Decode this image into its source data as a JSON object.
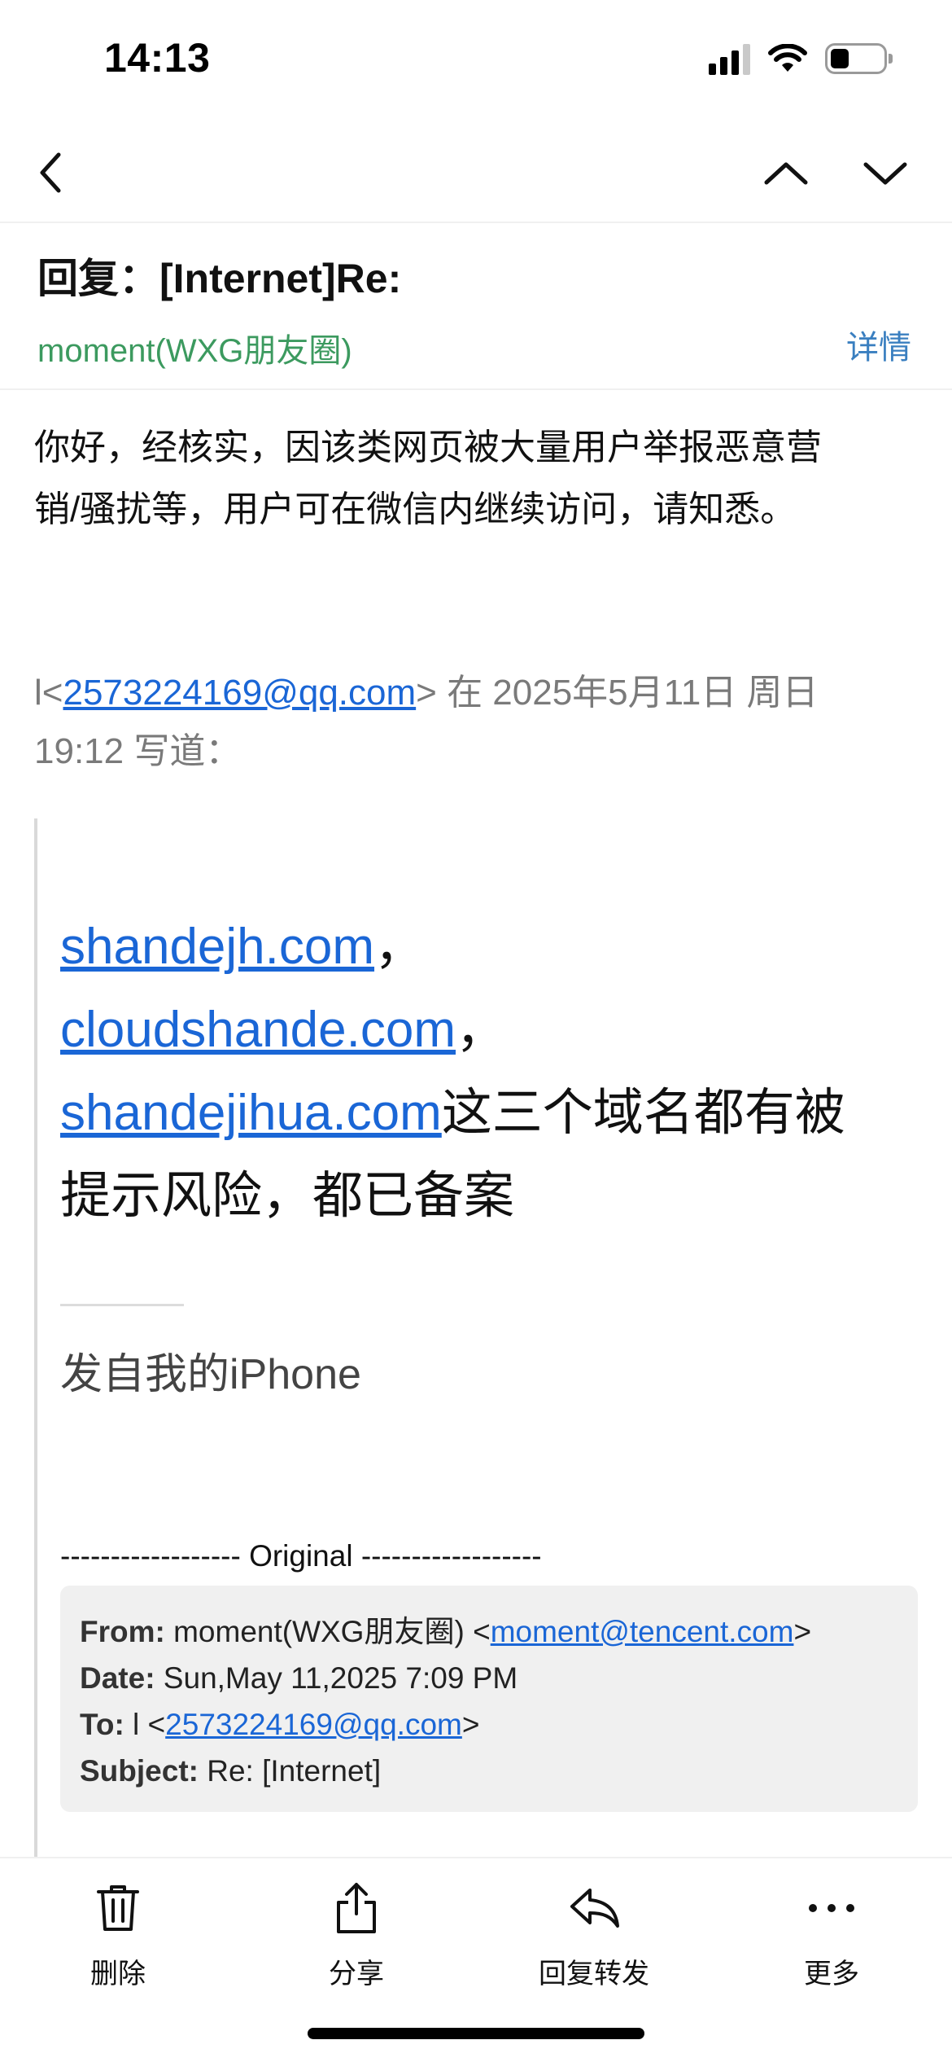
{
  "status_bar": {
    "time": "14:13"
  },
  "header": {
    "subject": "回复：[Internet]Re:",
    "sender": "moment(WXG朋友圈)",
    "details_label": "详情"
  },
  "body": {
    "line1": "你好，经核实，因该类网页被大量用户举报恶意营",
    "line2": "销/骚扰等，用户可在微信内继续访问，请知悉。"
  },
  "quote": {
    "prefix": "l<",
    "email": "2573224169@qq.com",
    "suffix": "> 在 2025年5月11日 周日",
    "line2": "19:12 写道："
  },
  "domains": {
    "d1": "shandejh.com",
    "sep1": "，",
    "d2": "cloudshande.com",
    "sep2": "，",
    "d3": "shandejihua.com",
    "tail1": "这三个域名都有被",
    "tail2": "提示风险，都已备案"
  },
  "signature": "发自我的iPhone",
  "original": {
    "divider_text": "------------------ Original ------------------",
    "from_label": "From:",
    "from_name": " moment(WXG朋友圈) <",
    "from_email": "moment@tencent.com",
    "from_close": ">",
    "date_label": "Date:",
    "date_value": " Sun,May 11,2025 7:09 PM",
    "to_label": "To:",
    "to_name": " l <",
    "to_email": "2573224169@qq.com",
    "to_close": ">",
    "subject_label": "Subject:",
    "subject_value": " Re: [Internet]"
  },
  "toolbar": {
    "delete_label": "删除",
    "share_label": "分享",
    "reply_label": "回复转发",
    "more_label": "更多"
  },
  "icons": {
    "back": "chevron-left-icon",
    "prev": "chevron-up-icon",
    "next": "chevron-down-icon",
    "delete": "trash-icon",
    "share": "share-icon",
    "reply": "reply-icon",
    "more": "ellipsis-icon"
  },
  "colors": {
    "sender_green": "#3c9a5f",
    "link_blue": "#1a66d6",
    "details_blue": "#3a7fc0"
  }
}
